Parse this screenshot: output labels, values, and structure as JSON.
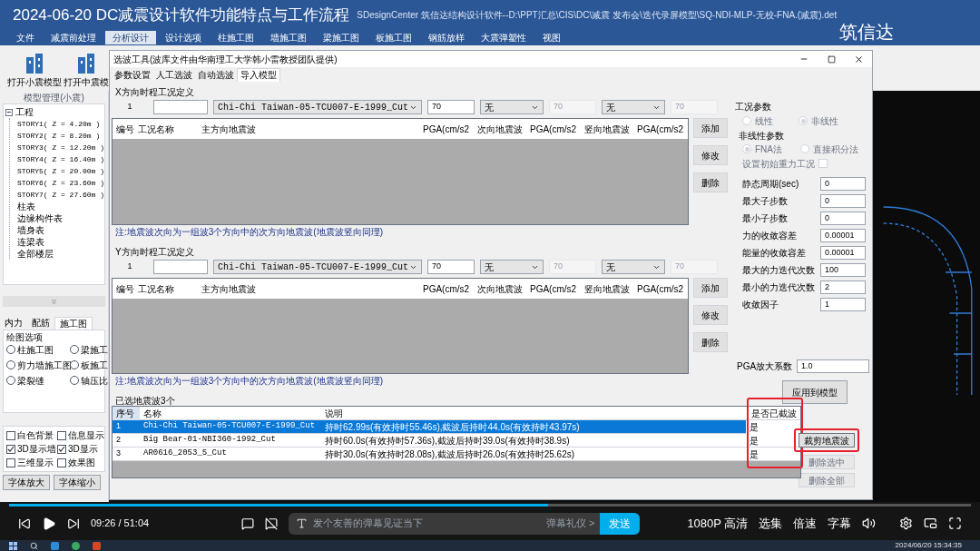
{
  "video_title": "2024-06-20 DC减震设计软件功能特点与工作流程",
  "app": {
    "title": "SDesignCenter 筑信达结构设计软件--D:\\PPT汇总\\CIS\\DC\\减震 发布会\\迭代录屏模型\\SQ-NDI-MLP-无校-FNA.(减震).det",
    "logo": "筑信达",
    "menu": [
      {
        "label": "文件",
        "selected": false
      },
      {
        "label": "减震前处理",
        "selected": false
      },
      {
        "label": "分析设计",
        "selected": true
      },
      {
        "label": "设计选项",
        "selected": false
      },
      {
        "label": "柱施工图",
        "selected": false
      },
      {
        "label": "墙施工图",
        "selected": false
      },
      {
        "label": "梁施工图",
        "selected": false
      },
      {
        "label": "板施工图",
        "selected": false
      },
      {
        "label": "钢筋放样",
        "selected": false
      },
      {
        "label": "大震弹塑性",
        "selected": false
      },
      {
        "label": "视图",
        "selected": false
      }
    ],
    "toolbar": [
      "打开小震模型",
      "打开中震模"
    ],
    "panel_title": "模型管理(小震)",
    "tree": {
      "label": "工程",
      "expanded": true,
      "children": [
        {
          "label": "STORY1( Z = 4.20m )"
        },
        {
          "label": "STORY2( Z = 8.20m )"
        },
        {
          "label": "STORY3( Z = 12.20m )"
        },
        {
          "label": "STORY4( Z = 16.40m )"
        },
        {
          "label": "STORY5( Z = 20.00m )"
        },
        {
          "label": "STORY6( Z = 23.60m )"
        },
        {
          "label": "STORY7( Z = 27.60m )"
        },
        {
          "label": "柱表"
        },
        {
          "label": "边缘构件表"
        },
        {
          "label": "墙身表"
        },
        {
          "label": "连梁表"
        },
        {
          "label": "全部楼层"
        }
      ]
    },
    "bottom_tabs": [
      {
        "label": "内力",
        "selected": false
      },
      {
        "label": "配筋",
        "selected": false
      },
      {
        "label": "施工图",
        "selected": true
      }
    ],
    "drawing_options": {
      "title": "绘图选项",
      "radios": [
        {
          "label": "柱施工图",
          "selected": false
        },
        {
          "label": "梁施工",
          "selected": false
        },
        {
          "label": "剪力墙施工图",
          "selected": false
        },
        {
          "label": "板施工",
          "selected": false
        },
        {
          "label": "梁裂缝",
          "selected": false
        },
        {
          "label": "轴压比",
          "selected": false
        }
      ]
    },
    "display_checks": [
      {
        "label": "白色背景",
        "checked": false
      },
      {
        "label": "信息显示",
        "checked": false
      },
      {
        "label": "3D显示墙",
        "checked": true
      },
      {
        "label": "3D显示",
        "checked": true
      },
      {
        "label": "三维显示",
        "checked": false
      },
      {
        "label": "效果图",
        "checked": false
      }
    ],
    "font_buttons": [
      "字体放大",
      "字体缩小"
    ]
  },
  "dialog": {
    "title": "选波工具(波库文件由华南理工大学韩小雷教授团队提供)",
    "tabs": [
      {
        "label": "参数设置",
        "selected": false
      },
      {
        "label": "人工选波",
        "selected": false
      },
      {
        "label": "自动选波",
        "selected": false
      },
      {
        "label": "导入模型",
        "selected": true
      }
    ],
    "sections": [
      {
        "title": "X方向时程工况定义",
        "index": "1",
        "main_wave": "Chi-Chi Taiwan-05-TCU007-E-1999_Cut",
        "main_pga": "70",
        "second_wave": "无",
        "second_pga": "70",
        "vertical_wave": "无",
        "vertical_pga": "70",
        "columns": [
          "编号",
          "工况名称",
          "主方向地震波",
          "PGA(cm/s2",
          "次向地震波",
          "PGA(cm/s2",
          "竖向地震波",
          "PGA(cm/s2"
        ],
        "buttons": [
          "添加",
          "修改",
          "删除"
        ],
        "note": "注:地震波次向为一组波3个方向中的次方向地震波(地震波竖向同理)"
      },
      {
        "title": "Y方向时程工况定义",
        "index": "1",
        "main_wave": "Chi-Chi Taiwan-05-TCU007-E-1999_Cut",
        "main_pga": "70",
        "second_wave": "无",
        "second_pga": "70",
        "vertical_wave": "无",
        "vertical_pga": "70",
        "columns": [
          "编号",
          "工况名称",
          "主方向地震波",
          "PGA(cm/s2",
          "次向地震波",
          "PGA(cm/s2",
          "竖向地震波",
          "PGA(cm/s2"
        ],
        "buttons": [
          "添加",
          "修改",
          "删除"
        ],
        "note": "注:地震波次向为一组波3个方向中的次方向地震波(地震波竖向同理)"
      }
    ],
    "selected_title": "已选地震波3个",
    "selected_columns": [
      "序号",
      "名称",
      "说明",
      "是否已截波"
    ],
    "selected_rows": [
      {
        "no": "1",
        "name": "Chi-Chi Taiwan-05-TCU007-E-1999_Cut",
        "desc": "持时62.99s(有效持时55.46s),截波后持时44.0s(有效持时43.97s)",
        "cut": "是",
        "selected": true
      },
      {
        "no": "2",
        "name": "Big Bear-01-NBI360-1992_Cut",
        "desc": "持时60.0s(有效持时57.36s),截波后持时39.0s(有效持时38.9s)",
        "cut": "是",
        "selected": false
      },
      {
        "no": "3",
        "name": "AR0616_2053_5_Cut",
        "desc": "持时30.0s(有效持时28.08s),截波后持时26.0s(有效持时25.62s)",
        "cut": "是",
        "selected": false
      }
    ],
    "side_buttons": [
      {
        "label": "裁剪地震波",
        "disabled": false
      },
      {
        "label": "删除选中",
        "disabled": true
      },
      {
        "label": "删除全部",
        "disabled": true
      }
    ],
    "params": {
      "title": "工况参数",
      "modes": [
        {
          "label": "线性",
          "selected": false,
          "disabled": true
        },
        {
          "label": "非线性",
          "selected": true,
          "disabled": true
        }
      ],
      "nonlinear_title": "非线性参数",
      "methods": [
        {
          "label": "FNA法",
          "selected": true,
          "disabled": true
        },
        {
          "label": "直接积分法",
          "selected": false,
          "disabled": true
        }
      ],
      "gravity": {
        "label": "设置初始重力工况",
        "checked": false
      },
      "fields": [
        {
          "label": "静态周期(sec)",
          "value": "0"
        },
        {
          "label": "最大子步数",
          "value": "0"
        },
        {
          "label": "最小子步数",
          "value": "0"
        },
        {
          "label": "力的收敛容差",
          "value": "0.00001"
        },
        {
          "label": "能量的收敛容差",
          "value": "0.00001"
        },
        {
          "label": "最大的力迭代次数",
          "value": "100"
        },
        {
          "label": "最小的力迭代次数",
          "value": "2"
        },
        {
          "label": "收敛因子",
          "value": "1"
        }
      ],
      "pga_label": "PGA放大系数",
      "pga_value": "1.0",
      "apply": "应用到模型"
    }
  },
  "player": {
    "progress": {
      "level": 0.56
    },
    "time": "09:26 / 51:04",
    "danmaku_placeholder": "发个友善的弹幕见证当下",
    "etiquette": "弹幕礼仪 >",
    "send": "发送",
    "options": [
      "1080P 高清",
      "选集",
      "倍速",
      "字幕"
    ]
  },
  "taskbar": {
    "clock": "2024/06/20 15:34:35"
  }
}
